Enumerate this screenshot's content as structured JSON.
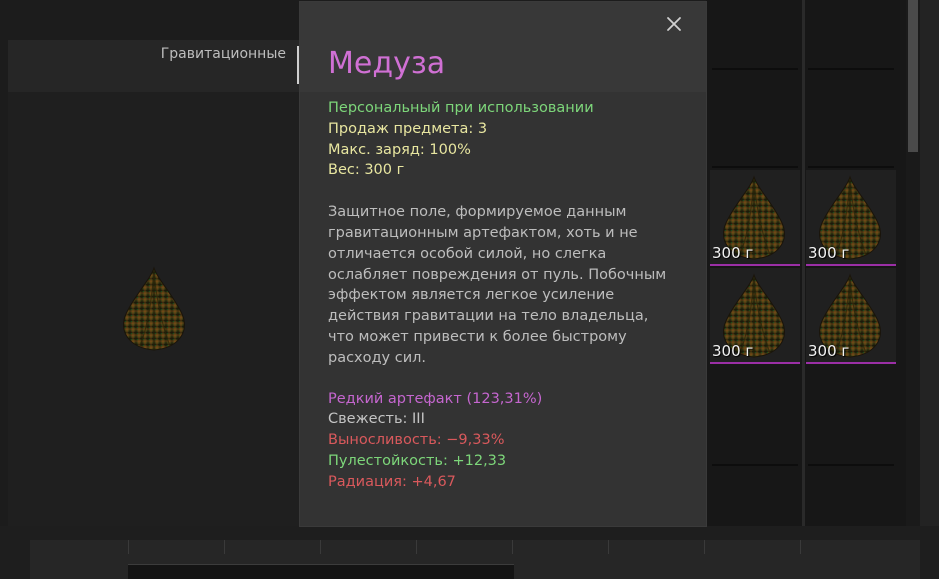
{
  "category": {
    "label": "Гравитационные"
  },
  "tooltip": {
    "title": "Медуза",
    "binding": "Персональный при использовании",
    "sell_count": "Продаж предмета: 3",
    "max_charge": "Макс. заряд: 100%",
    "weight": "Вес: 300 г",
    "description": "Защитное поле, формируемое данным гравитационным артефактом, хоть и не отличается особой силой, но слегка ослабляет повреждения от пуль. Побочным эффектом является легкое усиление действия гравитации на тело владельца, что может привести к более быстрому расходу сил.",
    "rarity": "Редкий артефакт (123,31%)",
    "freshness": "Свежесть: III",
    "stats": [
      {
        "text": "Выносливость: −9,33%",
        "kind": "negative"
      },
      {
        "text": "Пулестойкость: +12,33",
        "kind": "positive"
      },
      {
        "text": "Радиация: +4,67",
        "kind": "negative"
      }
    ]
  },
  "inventory": {
    "slots": [
      {
        "weight": "300 г"
      },
      {
        "weight": "300 г"
      },
      {
        "weight": "300 г"
      },
      {
        "weight": "300 г"
      }
    ]
  },
  "colors": {
    "title": "#d070d4",
    "positive": "#7dd67a",
    "negative": "#d9595c",
    "rarity": "#c566cf",
    "highlight": "#e8e6a0",
    "slot_border": "#9b2fa6"
  },
  "icons": {
    "close": "close-icon",
    "artifact": "medusa-artifact-icon"
  }
}
